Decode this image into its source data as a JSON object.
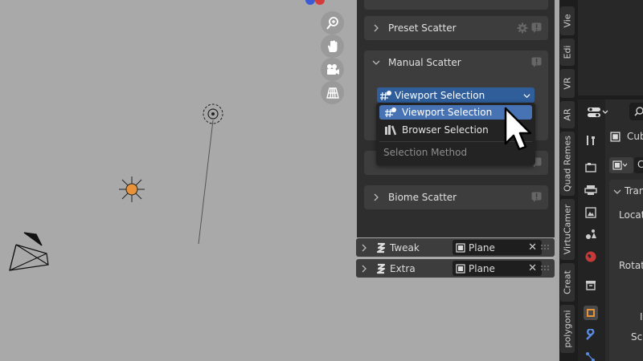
{
  "sidebar_panels": {
    "preset_scatter": "Preset Scatter",
    "manual_scatter": "Manual Scatter",
    "biome_scatter": "Biome Scatter"
  },
  "manual_scatter": {
    "selected_method": "Viewport Selection",
    "menu_items": [
      "Viewport Selection",
      "Browser Selection"
    ],
    "menu_caption": "Selection Method"
  },
  "modifiers": [
    {
      "name": "Tweak",
      "object": "Plane"
    },
    {
      "name": "Extra",
      "object": "Plane"
    }
  ],
  "vertical_tabs": [
    "Vie",
    "Edi",
    "VR",
    "AR",
    "Quad Remes",
    "VirtuCamer",
    "Creat",
    "polygoni"
  ],
  "properties": {
    "object_name": "Cub",
    "object_field": "C",
    "section_transform": "Tran",
    "location_label": "Locati",
    "rotation_label": "Rotatio",
    "mode_letter": "I",
    "scale_label": "Sc"
  },
  "icons": {
    "viewport_nav": [
      "zoom-icon",
      "hand-icon",
      "camera-icon",
      "grid-icon"
    ],
    "menu": [
      "viewport-selection-icon",
      "browser-selection-icon"
    ]
  },
  "colors": {
    "selection_blue": "#2f5e9b",
    "highlight_blue": "#4772b3",
    "light_orange": "#e8923a"
  }
}
